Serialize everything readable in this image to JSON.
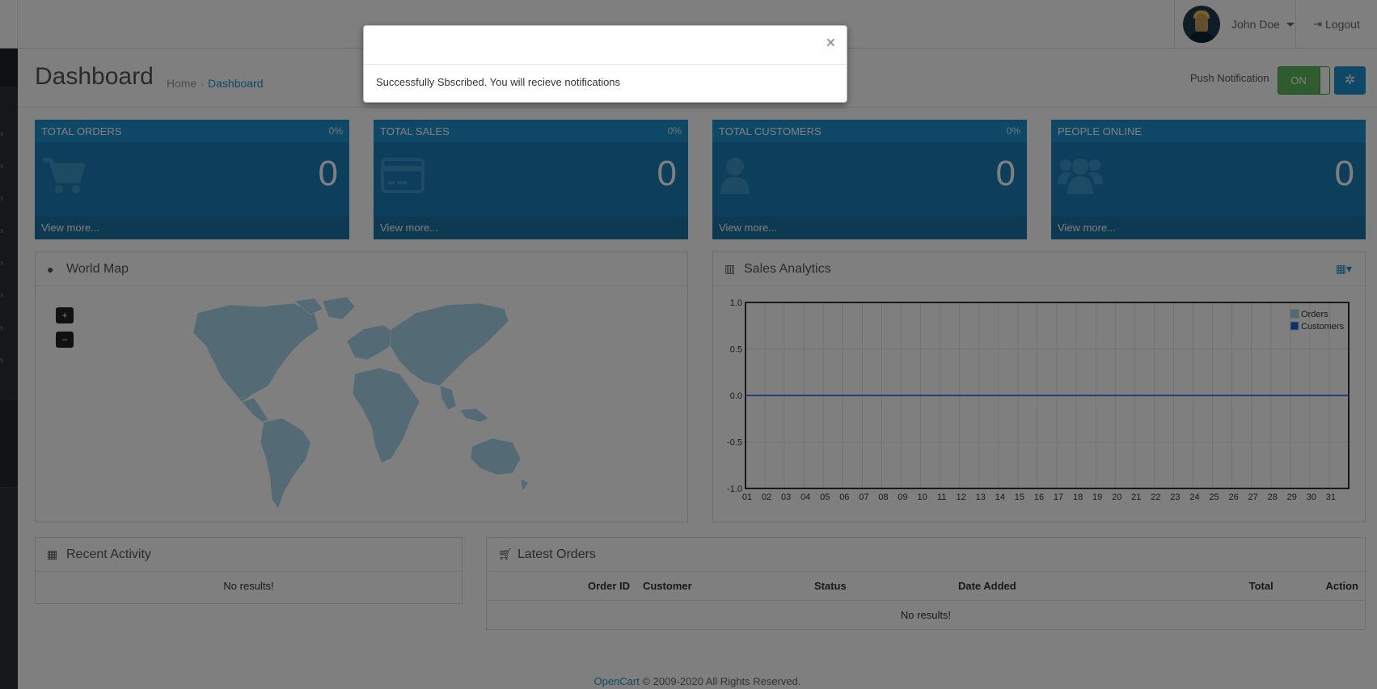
{
  "header": {
    "user_name": "John Doe",
    "logout_label": "Logout"
  },
  "page": {
    "title": "Dashboard",
    "breadcrumb": [
      "Home",
      "Dashboard"
    ],
    "push_label": "Push Notification",
    "toggle_state": "ON"
  },
  "tiles": [
    {
      "title": "TOTAL ORDERS",
      "percent": "0%",
      "value": "0",
      "footer": "View more...",
      "icon": "shopping-cart-icon"
    },
    {
      "title": "TOTAL SALES",
      "percent": "0%",
      "value": "0",
      "footer": "View more...",
      "icon": "credit-card-icon"
    },
    {
      "title": "TOTAL CUSTOMERS",
      "percent": "0%",
      "value": "0",
      "footer": "View more...",
      "icon": "user-icon"
    },
    {
      "title": "PEOPLE ONLINE",
      "percent": "",
      "value": "0",
      "footer": "View more...",
      "icon": "users-icon"
    }
  ],
  "world_map": {
    "title": "World Map",
    "zoom_in": "+",
    "zoom_out": "−"
  },
  "sales_analytics": {
    "title": "Sales Analytics"
  },
  "chart_data": {
    "type": "line",
    "title": "",
    "xlabel": "",
    "ylabel": "",
    "x": [
      "01",
      "02",
      "03",
      "04",
      "05",
      "06",
      "07",
      "08",
      "09",
      "10",
      "11",
      "12",
      "13",
      "14",
      "15",
      "16",
      "17",
      "18",
      "19",
      "20",
      "21",
      "22",
      "23",
      "24",
      "25",
      "26",
      "27",
      "28",
      "29",
      "30",
      "31"
    ],
    "yticks": [
      "1.0",
      "0.5",
      "0.0",
      "-0.5",
      "-1.0"
    ],
    "ylim": [
      -1.0,
      1.0
    ],
    "grid": true,
    "legend_position": "top-right",
    "series": [
      {
        "name": "Orders",
        "color": "#9fd5f1",
        "values": [
          0,
          0,
          0,
          0,
          0,
          0,
          0,
          0,
          0,
          0,
          0,
          0,
          0,
          0,
          0,
          0,
          0,
          0,
          0,
          0,
          0,
          0,
          0,
          0,
          0,
          0,
          0,
          0,
          0,
          0,
          0
        ]
      },
      {
        "name": "Customers",
        "color": "#1065d2",
        "values": [
          0,
          0,
          0,
          0,
          0,
          0,
          0,
          0,
          0,
          0,
          0,
          0,
          0,
          0,
          0,
          0,
          0,
          0,
          0,
          0,
          0,
          0,
          0,
          0,
          0,
          0,
          0,
          0,
          0,
          0,
          0
        ]
      }
    ]
  },
  "recent_activity": {
    "title": "Recent Activity",
    "empty": "No results!"
  },
  "latest_orders": {
    "title": "Latest Orders",
    "columns": [
      "Order ID",
      "Customer",
      "Status",
      "Date Added",
      "Total",
      "Action"
    ],
    "empty": "No results!"
  },
  "footer": {
    "brand": "OpenCart",
    "copyright": "© 2009-2020 All Rights Reserved."
  },
  "modal": {
    "close": "×",
    "message": "Successfully Sbscribed. You will recieve notifications"
  },
  "colors": {
    "accent": "#1e91cf",
    "toggle_on": "#5cb85c",
    "sidebar": "#2b2f34"
  }
}
